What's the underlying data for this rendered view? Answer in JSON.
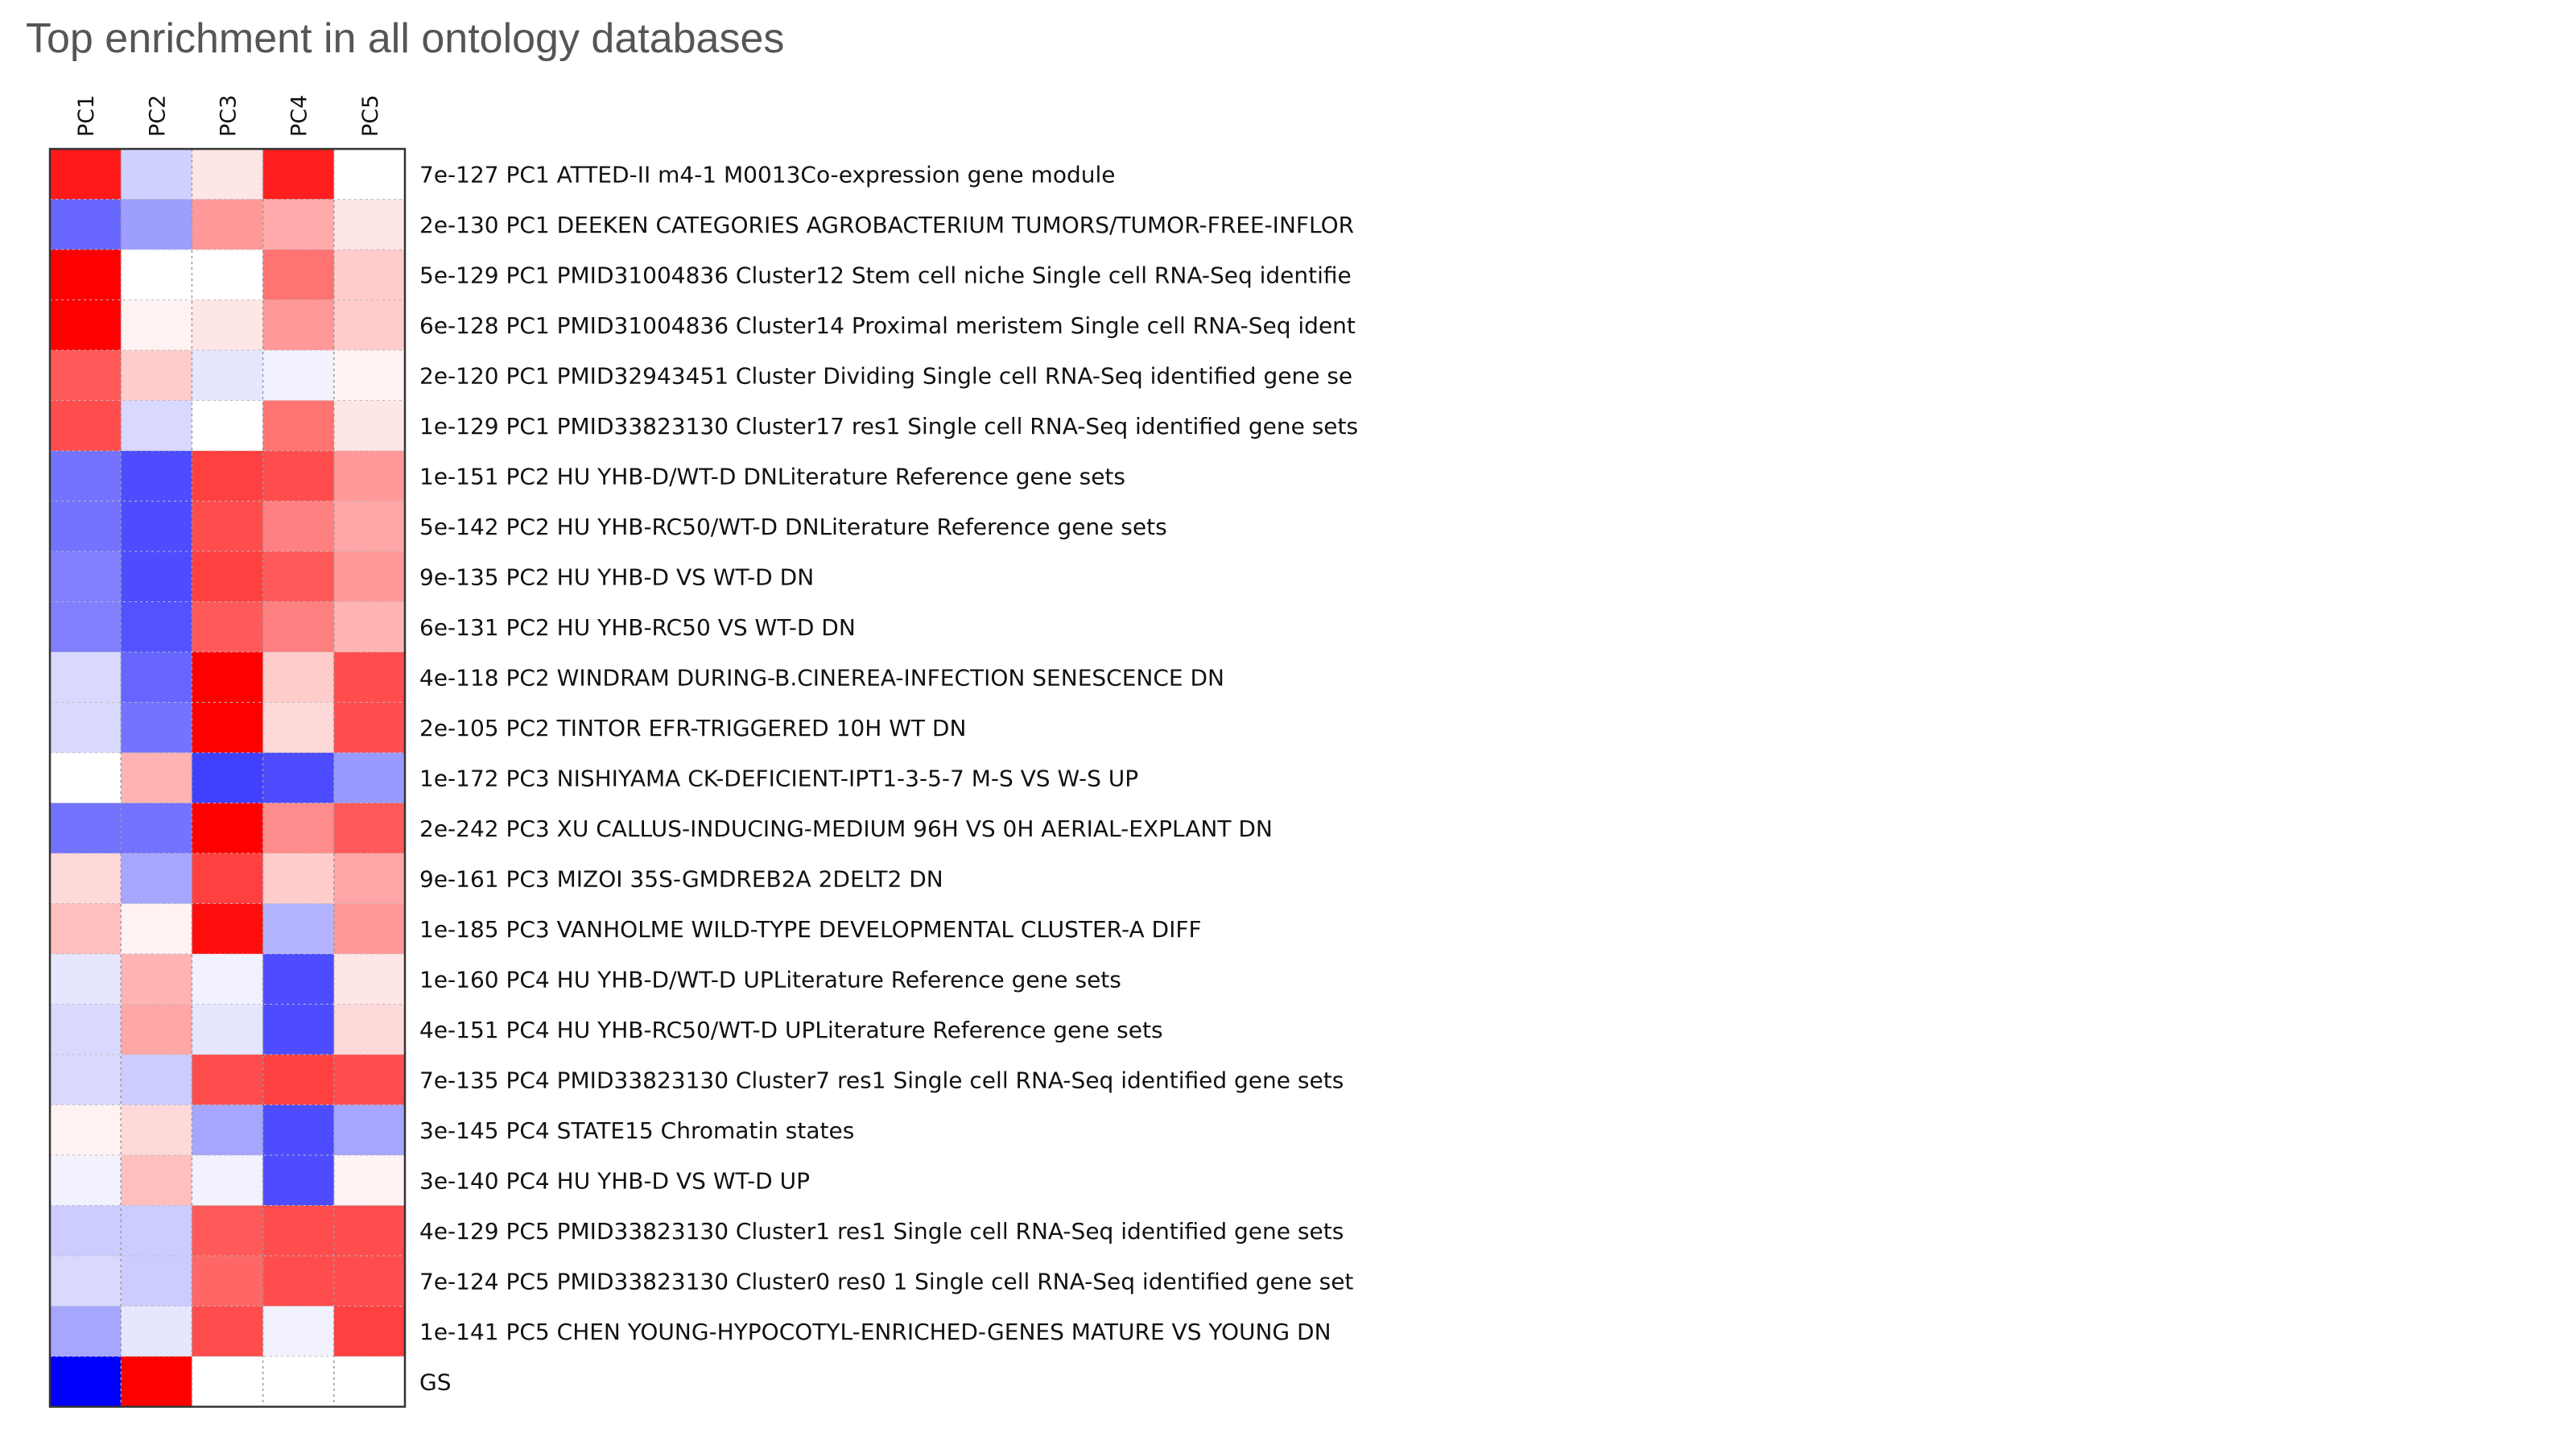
{
  "title": "Top enrichment in all ontology databases",
  "chart_data": {
    "type": "heatmap",
    "title": "Top enrichment in all ontology databases",
    "columns": [
      "PC1",
      "PC2",
      "PC3",
      "PC4",
      "PC5"
    ],
    "color_scale": {
      "min": -1,
      "max": 1,
      "low": "#0000ff",
      "mid": "#ffffff",
      "high": "#ff0000"
    },
    "rows": [
      {
        "label": "7e-127 PC1 ATTED-II m4-1 M0013Co-expression gene module",
        "values": [
          0.9,
          -0.18,
          0.1,
          0.88,
          0
        ]
      },
      {
        "label": "2e-130 PC1 DEEKEN CATEGORIES AGROBACTERIUM TUMORS/TUMOR-FREE-INFLOR",
        "values": [
          -0.6,
          -0.38,
          0.4,
          0.33,
          0.1
        ]
      },
      {
        "label": "5e-129 PC1 PMID31004836 Cluster12 Stem cell niche Single cell RNA-Seq identifie",
        "values": [
          1,
          0,
          0,
          0.55,
          0.2
        ]
      },
      {
        "label": "6e-128 PC1 PMID31004836 Cluster14 Proximal meristem Single cell RNA-Seq ident",
        "values": [
          1,
          0.05,
          0.1,
          0.4,
          0.2
        ]
      },
      {
        "label": "2e-120 PC1 PMID32943451 Cluster Dividing Single cell RNA-Seq identified gene se",
        "values": [
          0.65,
          0.2,
          -0.1,
          -0.05,
          0.05
        ]
      },
      {
        "label": "1e-129 PC1 PMID33823130 Cluster17 res1 Single cell RNA-Seq identified gene sets",
        "values": [
          0.7,
          -0.15,
          0,
          0.55,
          0.1
        ]
      },
      {
        "label": "1e-151 PC2 HU YHB-D/WT-D DNLiterature Reference gene sets",
        "values": [
          -0.55,
          -0.7,
          0.75,
          0.7,
          0.4
        ]
      },
      {
        "label": "5e-142 PC2 HU YHB-RC50/WT-D DNLiterature Reference gene sets",
        "values": [
          -0.55,
          -0.7,
          0.7,
          0.5,
          0.35
        ]
      },
      {
        "label": "9e-135 PC2 HU YHB-D VS WT-D DN",
        "values": [
          -0.5,
          -0.7,
          0.75,
          0.65,
          0.4
        ]
      },
      {
        "label": "6e-131 PC2 HU YHB-RC50 VS WT-D DN",
        "values": [
          -0.5,
          -0.68,
          0.65,
          0.5,
          0.3
        ]
      },
      {
        "label": "4e-118 PC2 WINDRAM DURING-B.CINEREA-INFECTION SENESCENCE DN",
        "values": [
          -0.15,
          -0.6,
          1,
          0.2,
          0.7
        ]
      },
      {
        "label": "2e-105 PC2 TINTOR EFR-TRIGGERED 10H WT DN",
        "values": [
          -0.15,
          -0.55,
          1,
          0.15,
          0.7
        ]
      },
      {
        "label": "1e-172 PC3 NISHIYAMA CK-DEFICIENT-IPT1-3-5-7 M-S VS W-S UP",
        "values": [
          0,
          0.3,
          -0.75,
          -0.7,
          -0.4
        ]
      },
      {
        "label": "2e-242 PC3 XU CALLUS-INDUCING-MEDIUM 96H VS 0H AERIAL-EXPLANT DN",
        "values": [
          -0.55,
          -0.55,
          1,
          0.45,
          0.65
        ]
      },
      {
        "label": "9e-161 PC3 MIZOI 35S-GMDREB2A 2DELT2 DN",
        "values": [
          0.15,
          -0.35,
          0.75,
          0.2,
          0.35
        ]
      },
      {
        "label": "1e-185 PC3 VANHOLME WILD-TYPE DEVELOPMENTAL CLUSTER-A DIFF",
        "values": [
          0.25,
          0.05,
          0.95,
          -0.3,
          0.4
        ]
      },
      {
        "label": "1e-160 PC4 HU YHB-D/WT-D UPLiterature Reference gene sets",
        "values": [
          -0.1,
          0.3,
          -0.05,
          -0.7,
          0.1
        ]
      },
      {
        "label": "4e-151 PC4 HU YHB-RC50/WT-D UPLiterature Reference gene sets",
        "values": [
          -0.15,
          0.35,
          -0.1,
          -0.7,
          0.15
        ]
      },
      {
        "label": "7e-135 PC4 PMID33823130 Cluster7 res1 Single cell RNA-Seq identified gene sets",
        "values": [
          -0.15,
          -0.2,
          0.7,
          0.75,
          0.7
        ]
      },
      {
        "label": "3e-145 PC4 STATE15 Chromatin states",
        "values": [
          0.05,
          0.15,
          -0.35,
          -0.7,
          -0.35
        ]
      },
      {
        "label": "3e-140 PC4 HU YHB-D VS WT-D UP",
        "values": [
          -0.05,
          0.25,
          -0.05,
          -0.7,
          0.05
        ]
      },
      {
        "label": "4e-129 PC5 PMID33823130 Cluster1 res1 Single cell RNA-Seq identified gene sets",
        "values": [
          -0.2,
          -0.2,
          0.65,
          0.7,
          0.7
        ]
      },
      {
        "label": "7e-124 PC5 PMID33823130 Cluster0 res0 1 Single cell RNA-Seq identified gene set",
        "values": [
          -0.15,
          -0.2,
          0.6,
          0.7,
          0.7
        ]
      },
      {
        "label": "1e-141 PC5 CHEN YOUNG-HYPOCOTYL-ENRICHED-GENES MATURE VS YOUNG DN",
        "values": [
          -0.35,
          -0.1,
          0.7,
          -0.05,
          0.75
        ]
      },
      {
        "label": "GS",
        "values": [
          -1,
          1,
          0,
          0,
          0
        ]
      }
    ]
  }
}
